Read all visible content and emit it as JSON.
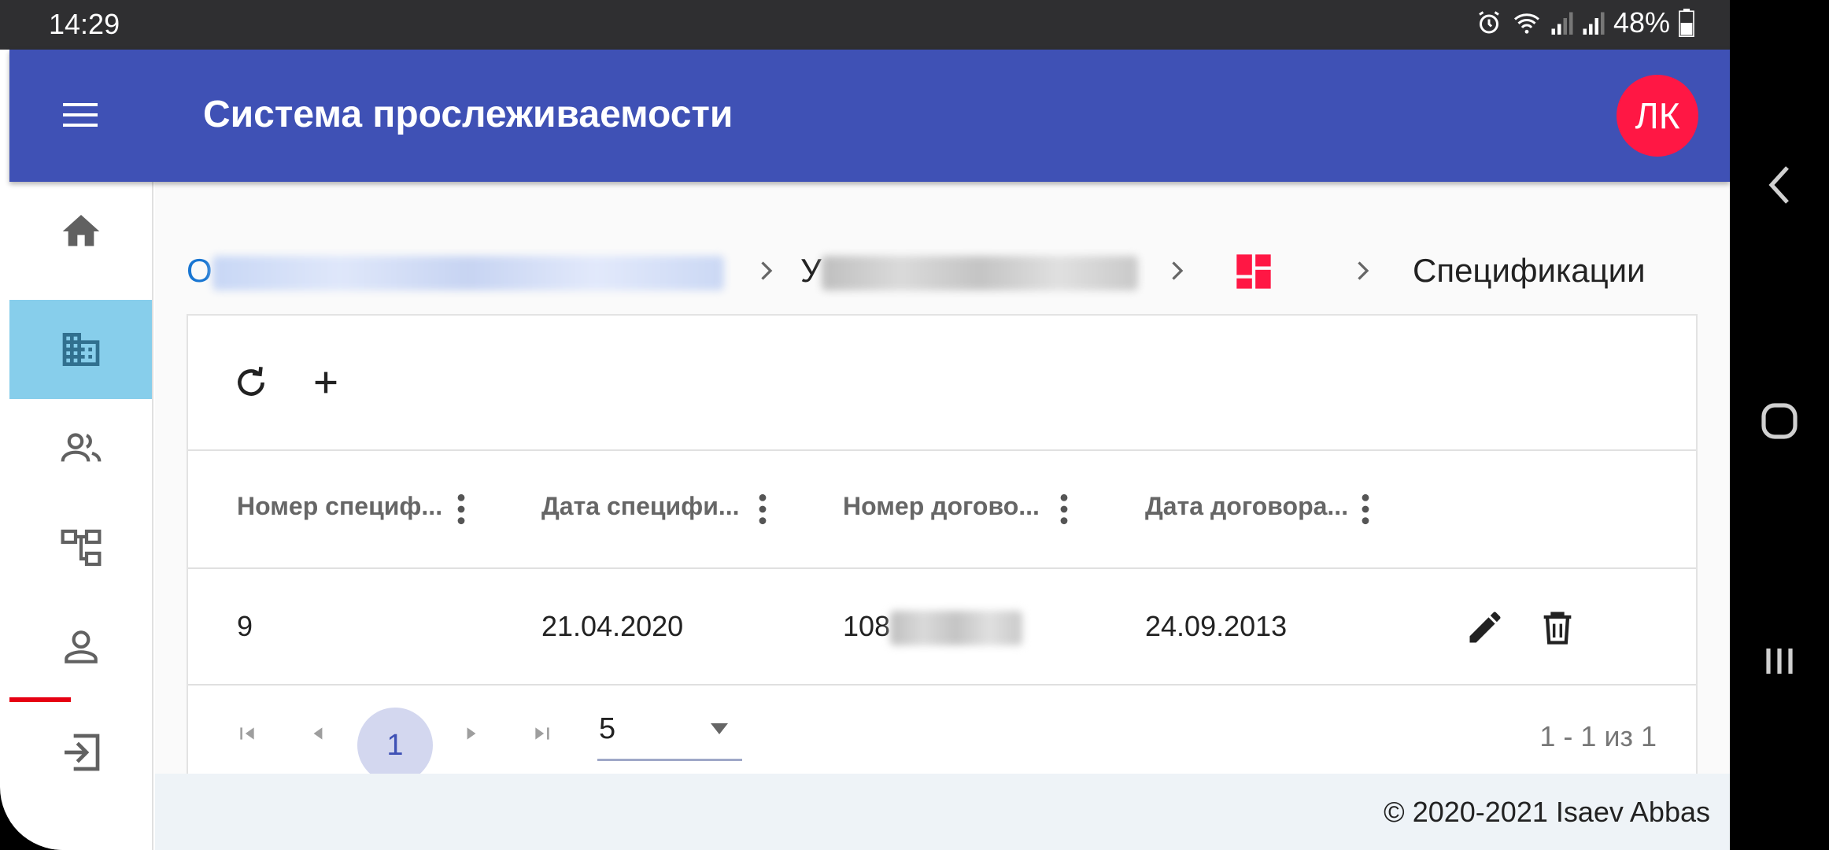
{
  "status_bar": {
    "time": "14:29",
    "battery": "48%",
    "icons": [
      "alarm-icon",
      "wifi-icon",
      "signal-icon",
      "signal-icon",
      "battery-icon"
    ]
  },
  "app_bar": {
    "title": "Система прослеживаемости",
    "avatar_initials": "ЛК",
    "menu_icon": "hamburger-menu-icon",
    "avatar_color": "#ff1744",
    "bar_color": "#3f51b5"
  },
  "sidebar": {
    "items": [
      {
        "icon": "home-icon",
        "active": false
      },
      {
        "icon": "building-icon",
        "active": true
      },
      {
        "icon": "people-icon",
        "active": false
      },
      {
        "icon": "hierarchy-icon",
        "active": false
      },
      {
        "icon": "person-icon",
        "active": false
      },
      {
        "icon": "logout-icon",
        "active": false
      }
    ],
    "active_color": "#87ceeb"
  },
  "breadcrumb": {
    "item1_initial": "О",
    "item2_initial": "У",
    "item3_icon": "dashboard-icon",
    "item4": "Спецификации"
  },
  "toolbar": {
    "refresh_icon": "refresh-icon",
    "add_icon": "add-icon",
    "add_label": "+"
  },
  "table": {
    "columns": [
      "Номер специф...",
      "Дата специфи...",
      "Номер догово...",
      "Дата договора..."
    ],
    "rows": [
      {
        "spec_number": "9",
        "spec_date": "21.04.2020",
        "contract_number_prefix": "108",
        "contract_date": "24.09.2013"
      }
    ],
    "row_actions": [
      "edit-icon",
      "delete-icon"
    ]
  },
  "pager": {
    "current_page": "1",
    "page_size": "5",
    "info": "1 - 1 из 1"
  },
  "footer": {
    "copyright": "© 2020-2021 Isaev Abbas"
  }
}
